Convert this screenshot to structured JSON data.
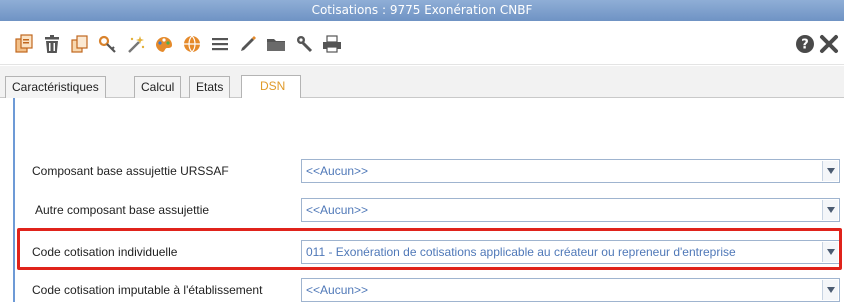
{
  "window": {
    "title": "Cotisations : 9775 Exonération  CNBF"
  },
  "toolbar": {
    "left_icons": [
      "copy-icon",
      "trash-icon",
      "duplicate-icon",
      "key-link-icon",
      "magic-wand-icon",
      "color-palette-icon",
      "globe-icon",
      "list-lines-icon",
      "pencil-tool-icon",
      "folder-icon",
      "wrench-icon",
      "print-icon"
    ],
    "help_icon": "help-icon",
    "close_icon": "close-icon"
  },
  "tabs": [
    {
      "label": "Caractéristiques",
      "active": false
    },
    {
      "label": "Calcul",
      "active": false
    },
    {
      "label": "Etats",
      "active": false
    },
    {
      "label": "DSN",
      "active": true
    }
  ],
  "form": {
    "rows": [
      {
        "label": "Composant base assujettie URSSAF",
        "value": "<<Aucun>>"
      },
      {
        "label": "Autre composant base assujettie",
        "value": "<<Aucun>>"
      },
      {
        "label": "Code cotisation individuelle",
        "value": "011 - Exonération de cotisations applicable au créateur ou repreneur d'entreprise",
        "highlighted": true
      },
      {
        "label": "Code cotisation imputable à l'établissement",
        "value": "<<Aucun>>"
      }
    ]
  },
  "colors": {
    "titlebar": "#7b9dcb",
    "active_tab_text": "#e09a2a",
    "field_text": "#4f78b8",
    "highlight_border": "#e0231b"
  }
}
